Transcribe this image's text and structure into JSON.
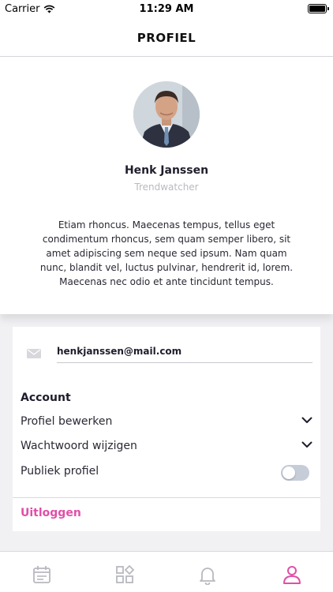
{
  "status_bar": {
    "carrier": "Carrier",
    "time": "11:29 AM"
  },
  "nav": {
    "title": "PROFIEL"
  },
  "profile": {
    "name": "Henk Janssen",
    "role": "Trendwatcher",
    "bio": "Etiam rhoncus. Maecenas tempus, tellus eget condimentum rhoncus, sem quam semper libero, sit amet adipiscing sem neque sed ipsum. Nam quam nunc, blandit vel, luctus pulvinar, hendrerit id, lorem. Maecenas nec odio et ante tincidunt tempus."
  },
  "settings": {
    "email": "henkjanssen@mail.com",
    "section_title": "Account",
    "edit_profile": "Profiel bewerken",
    "change_password": "Wachtwoord wijzigen",
    "public_profile": "Publiek profiel",
    "public_profile_enabled": false,
    "logout": "Uitloggen"
  },
  "tabs": [
    {
      "icon": "calendar-icon",
      "active": false
    },
    {
      "icon": "apps-icon",
      "active": false
    },
    {
      "icon": "bell-icon",
      "active": false
    },
    {
      "icon": "user-icon",
      "active": true
    }
  ],
  "colors": {
    "accent": "#e04fa8",
    "inactive_icon": "#b8b8c0",
    "toggle_off": "#c6cdd9"
  }
}
